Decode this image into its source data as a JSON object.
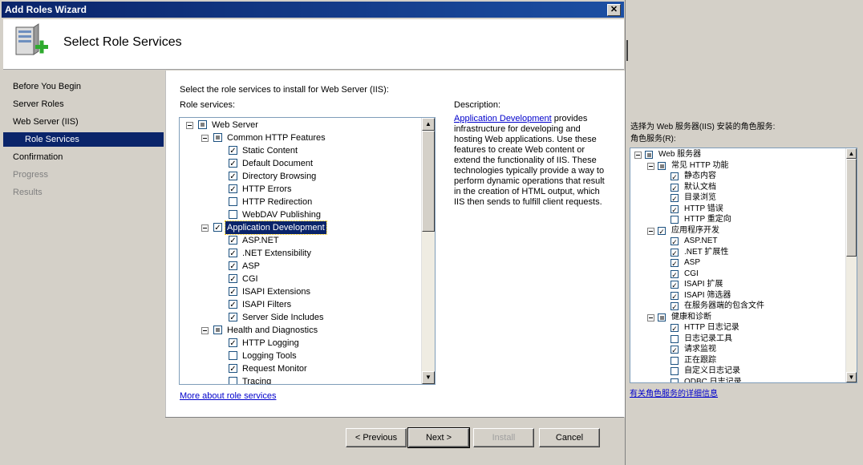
{
  "window": {
    "title": "Add Roles Wizard",
    "close": "✕"
  },
  "header": {
    "title": "Select Role Services"
  },
  "nav": [
    {
      "label": "Before You Begin",
      "state": "normal"
    },
    {
      "label": "Server Roles",
      "state": "normal"
    },
    {
      "label": "Web Server (IIS)",
      "state": "normal"
    },
    {
      "label": "Role Services",
      "state": "selected"
    },
    {
      "label": "Confirmation",
      "state": "normal"
    },
    {
      "label": "Progress",
      "state": "disabled"
    },
    {
      "label": "Results",
      "state": "disabled"
    }
  ],
  "content": {
    "instruction": "Select the role services to install for Web Server (IIS):",
    "role_services_label": "Role services:",
    "description_label": "Description:",
    "description_link": "Application Development",
    "description_text": " provides infrastructure for developing and hosting Web applications. Use these features to create Web content or extend the functionality of IIS. These technologies typically provide a way to perform dynamic operations that result in the creation of HTML output, which IIS then sends to fulfill client requests.",
    "more_link": "More about role services"
  },
  "tree": [
    {
      "level": 0,
      "label": "Web Server",
      "state": "partial",
      "expander": true
    },
    {
      "level": 1,
      "label": "Common HTTP Features",
      "state": "partial",
      "expander": true
    },
    {
      "level": 2,
      "label": "Static Content",
      "state": "checked"
    },
    {
      "level": 2,
      "label": "Default Document",
      "state": "checked"
    },
    {
      "level": 2,
      "label": "Directory Browsing",
      "state": "checked"
    },
    {
      "level": 2,
      "label": "HTTP Errors",
      "state": "checked"
    },
    {
      "level": 2,
      "label": "HTTP Redirection",
      "state": "unchecked"
    },
    {
      "level": 2,
      "label": "WebDAV Publishing",
      "state": "unchecked"
    },
    {
      "level": 1,
      "label": "Application Development",
      "state": "checked",
      "expander": true,
      "selected": true
    },
    {
      "level": 2,
      "label": "ASP.NET",
      "state": "checked"
    },
    {
      "level": 2,
      "label": ".NET Extensibility",
      "state": "checked"
    },
    {
      "level": 2,
      "label": "ASP",
      "state": "checked"
    },
    {
      "level": 2,
      "label": "CGI",
      "state": "checked"
    },
    {
      "level": 2,
      "label": "ISAPI Extensions",
      "state": "checked"
    },
    {
      "level": 2,
      "label": "ISAPI Filters",
      "state": "checked"
    },
    {
      "level": 2,
      "label": "Server Side Includes",
      "state": "checked"
    },
    {
      "level": 1,
      "label": "Health and Diagnostics",
      "state": "partial",
      "expander": true
    },
    {
      "level": 2,
      "label": "HTTP Logging",
      "state": "checked"
    },
    {
      "level": 2,
      "label": "Logging Tools",
      "state": "unchecked"
    },
    {
      "level": 2,
      "label": "Request Monitor",
      "state": "checked"
    },
    {
      "level": 2,
      "label": "Tracing",
      "state": "unchecked"
    }
  ],
  "buttons": {
    "previous": "< Previous",
    "next": "Next >",
    "install": "Install",
    "cancel": "Cancel"
  },
  "cn": {
    "instruction": "选择为 Web 服务器(IIS) 安装的角色服务:",
    "role_services_label": "角色服务(R):",
    "more_link": "有关角色服务的详细信息",
    "tree": [
      {
        "level": 0,
        "label": "Web 服务器",
        "state": "partial",
        "expander": true
      },
      {
        "level": 1,
        "label": "常见 HTTP 功能",
        "state": "partial",
        "expander": true
      },
      {
        "level": 2,
        "label": "静态内容",
        "state": "checked"
      },
      {
        "level": 2,
        "label": "默认文档",
        "state": "checked"
      },
      {
        "level": 2,
        "label": "目录浏览",
        "state": "checked"
      },
      {
        "level": 2,
        "label": "HTTP 错误",
        "state": "checked"
      },
      {
        "level": 2,
        "label": "HTTP 重定向",
        "state": "unchecked"
      },
      {
        "level": 1,
        "label": "应用程序开发",
        "state": "checked",
        "expander": true
      },
      {
        "level": 2,
        "label": "ASP.NET",
        "state": "checked"
      },
      {
        "level": 2,
        "label": ".NET 扩展性",
        "state": "checked"
      },
      {
        "level": 2,
        "label": "ASP",
        "state": "checked"
      },
      {
        "level": 2,
        "label": "CGI",
        "state": "checked"
      },
      {
        "level": 2,
        "label": "ISAPI 扩展",
        "state": "checked"
      },
      {
        "level": 2,
        "label": "ISAPI 筛选器",
        "state": "checked"
      },
      {
        "level": 2,
        "label": "在服务器端的包含文件",
        "state": "checked"
      },
      {
        "level": 1,
        "label": "健康和诊断",
        "state": "partial",
        "expander": true
      },
      {
        "level": 2,
        "label": "HTTP 日志记录",
        "state": "checked"
      },
      {
        "level": 2,
        "label": "日志记录工具",
        "state": "unchecked"
      },
      {
        "level": 2,
        "label": "请求监视",
        "state": "checked"
      },
      {
        "level": 2,
        "label": "正在跟踪",
        "state": "unchecked"
      },
      {
        "level": 2,
        "label": "自定义日志记录",
        "state": "unchecked"
      },
      {
        "level": 2,
        "label": "ODBC 日志记录",
        "state": "unchecked"
      }
    ]
  }
}
